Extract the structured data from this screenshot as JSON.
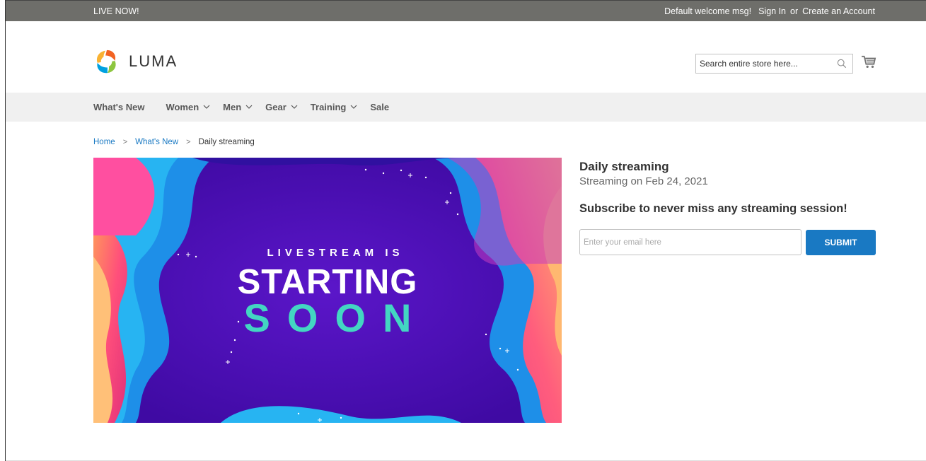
{
  "topbar": {
    "promo": "LIVE NOW!",
    "welcome": "Default welcome msg!",
    "sign_in": "Sign In",
    "or": "or",
    "create_account": "Create an Account"
  },
  "header": {
    "brand": "LUMA",
    "search_placeholder": "Search entire store here...",
    "icons": [
      "luma-logo-icon",
      "search-icon",
      "cart-icon"
    ]
  },
  "nav": {
    "items": [
      {
        "label": "What's New",
        "has_submenu": false
      },
      {
        "label": "Women",
        "has_submenu": true
      },
      {
        "label": "Men",
        "has_submenu": true
      },
      {
        "label": "Gear",
        "has_submenu": true
      },
      {
        "label": "Training",
        "has_submenu": true
      },
      {
        "label": "Sale",
        "has_submenu": false
      }
    ]
  },
  "breadcrumb": {
    "home": "Home",
    "section": "What's New",
    "current": "Daily streaming"
  },
  "hero": {
    "line1": "LIVESTREAM IS",
    "line2": "STARTING",
    "line3": "SOON"
  },
  "stream": {
    "title": "Daily streaming",
    "date": "Streaming on Feb 24, 2021",
    "subscribe_heading": "Subscribe to never miss any streaming session!",
    "email_placeholder": "Enter your email here",
    "submit_label": "SUBMIT"
  },
  "colors": {
    "topbar": "#6e6e6a",
    "nav_bg": "#f0f0f0",
    "link": "#1979c3",
    "button": "#1979c3",
    "hero_bg": "#4a0fb5",
    "hero_accent": "#43d6c2"
  }
}
